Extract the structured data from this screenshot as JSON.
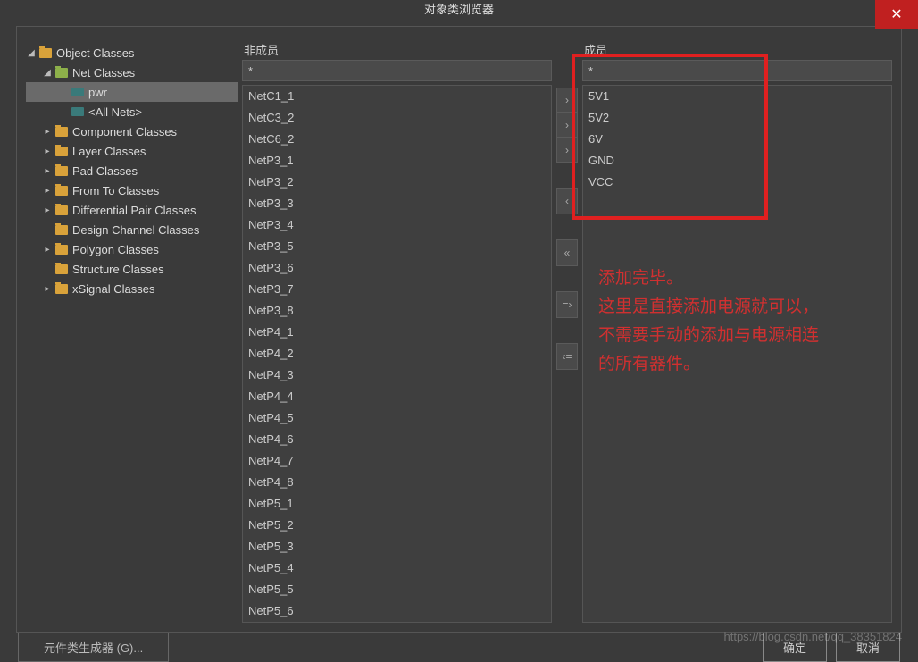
{
  "window": {
    "title": "对象类浏览器"
  },
  "tree": {
    "root": "Object Classes",
    "nodes": [
      {
        "label": "Net Classes",
        "expanded": true,
        "children": [
          {
            "label": "pwr",
            "selected": true,
            "icon": "net"
          },
          {
            "label": "<All Nets>",
            "icon": "net"
          }
        ]
      },
      {
        "label": "Component Classes"
      },
      {
        "label": "Layer Classes"
      },
      {
        "label": "Pad Classes"
      },
      {
        "label": "From To Classes"
      },
      {
        "label": "Differential Pair Classes"
      },
      {
        "label": "Design Channel Classes",
        "noexpand": true
      },
      {
        "label": "Polygon Classes"
      },
      {
        "label": "Structure Classes",
        "noexpand": true
      },
      {
        "label": "xSignal Classes"
      }
    ]
  },
  "nonmembers": {
    "label": "非成员",
    "filter": "*",
    "items": [
      "NetC1_1",
      "NetC3_2",
      "NetC6_2",
      "NetP3_1",
      "NetP3_2",
      "NetP3_3",
      "NetP3_4",
      "NetP3_5",
      "NetP3_6",
      "NetP3_7",
      "NetP3_8",
      "NetP4_1",
      "NetP4_2",
      "NetP4_3",
      "NetP4_4",
      "NetP4_5",
      "NetP4_6",
      "NetP4_7",
      "NetP4_8",
      "NetP5_1",
      "NetP5_2",
      "NetP5_3",
      "NetP5_4",
      "NetP5_5",
      "NetP5_6"
    ]
  },
  "members": {
    "label": "成员",
    "filter": "*",
    "items": [
      "5V1",
      "5V2",
      "6V",
      "GND",
      "VCC"
    ]
  },
  "transfer": {
    "add": "›",
    "addgap": "›",
    "remove": "‹",
    "add_all": "«",
    "eq": "=›",
    "remove_all": "‹="
  },
  "footer": {
    "generator": "元件类生成器 (G)...",
    "ok": "确定",
    "cancel": "取消"
  },
  "annotation": {
    "line1": "添加完毕。",
    "line2": "这里是直接添加电源就可以，",
    "line3": "不需要手动的添加与电源相连",
    "line4": "的所有器件。"
  },
  "watermark": "https://blog.csdn.net/qq_38351824"
}
